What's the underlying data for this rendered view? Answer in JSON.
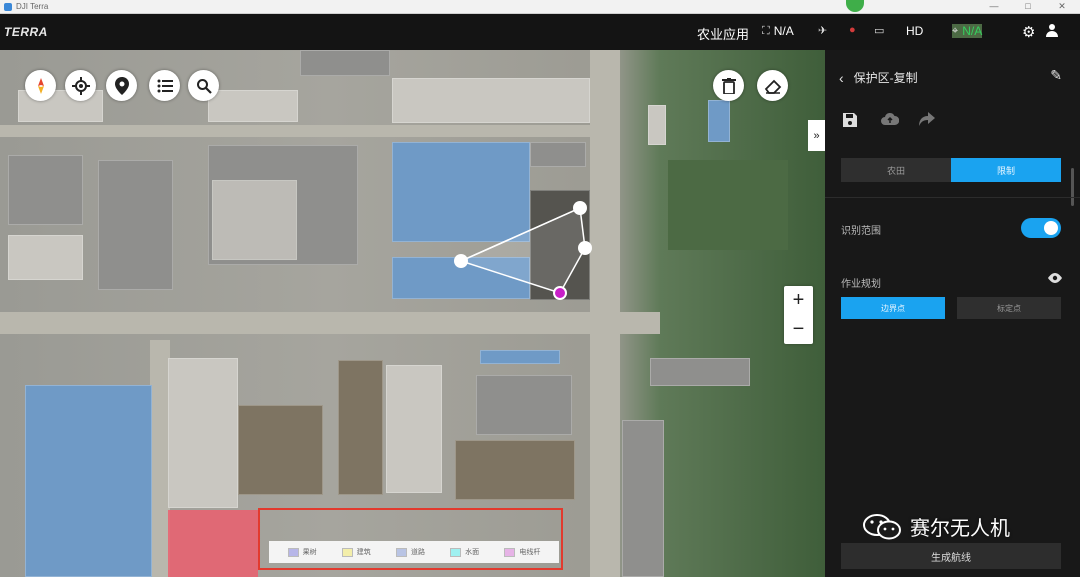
{
  "window": {
    "title": "DJI Terra",
    "controls": [
      "—",
      "□",
      "✕"
    ]
  },
  "app": {
    "brand": "TERRA"
  },
  "topbar": {
    "mode": "农业应用",
    "stats": [
      {
        "icon": "rtk-icon",
        "glyph": "⛶",
        "value": "N/A"
      },
      {
        "icon": "drone-signal-icon",
        "glyph": "✈",
        "value": ""
      },
      {
        "icon": "camera-rec-icon",
        "glyph": "●",
        "value": ""
      },
      {
        "icon": "battery-icon",
        "glyph": "▭",
        "value": ""
      },
      {
        "icon": "hd-signal-icon",
        "glyph": "",
        "value": "HD"
      },
      {
        "icon": "gps-icon",
        "glyph": "⌖",
        "value": "N/A"
      }
    ]
  },
  "map": {
    "zoom_in": "+",
    "zoom_out": "−",
    "expand": "»",
    "legend": [
      {
        "label": "果树",
        "color": "#b7b6e8"
      },
      {
        "label": "建筑",
        "color": "#f3eeaa"
      },
      {
        "label": "道路",
        "color": "#b9c4e4"
      },
      {
        "label": "水面",
        "color": "#9ff0f0"
      },
      {
        "label": "电线杆",
        "color": "#e6b3e6"
      }
    ]
  },
  "panel": {
    "title": "保护区-复制",
    "tabs": {
      "farmland": "农田",
      "restricted": "限制"
    },
    "toggle_label": "识别范围",
    "toggle_on": true,
    "section_label": "作业规划",
    "btn_boundary": "边界点",
    "btn_calibration": "标定点",
    "generate": "生成航线"
  },
  "watermark": "赛尔无人机",
  "colors": {
    "accent": "#1aa3f0",
    "vertex_selected": "#c81fc8",
    "legend_border": "#e23a2e"
  }
}
